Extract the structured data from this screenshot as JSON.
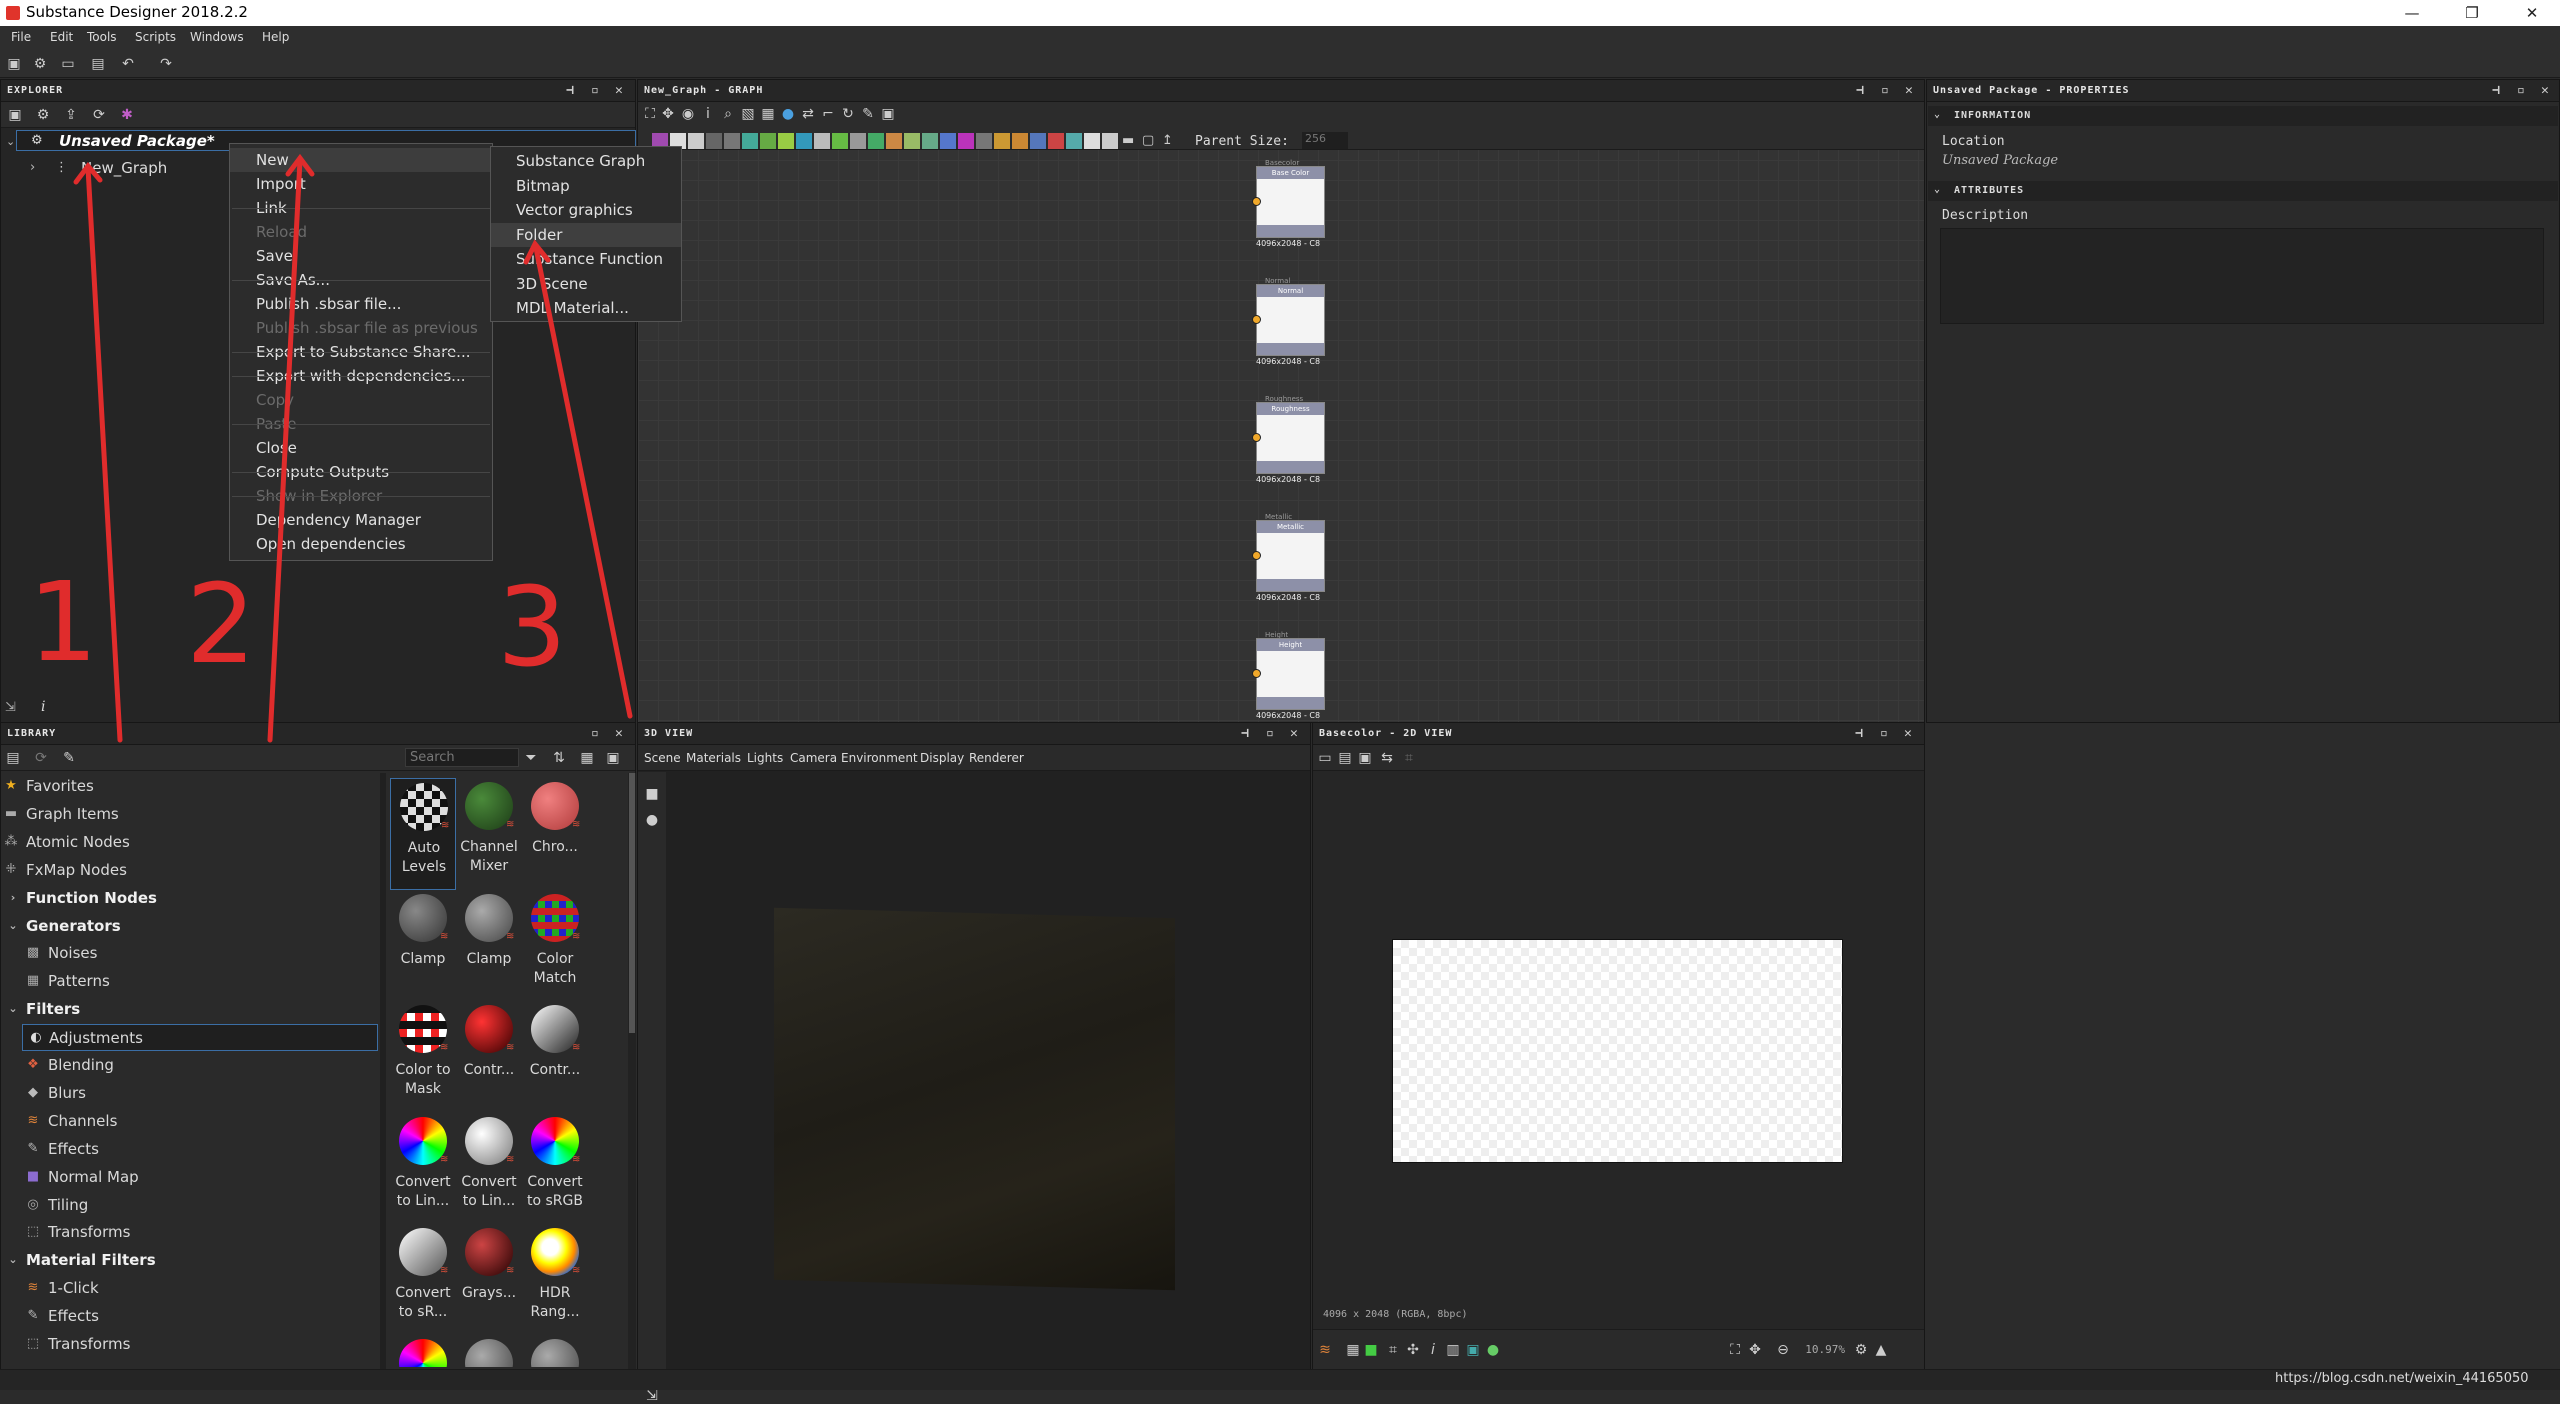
{
  "app": {
    "title": "Substance Designer 2018.2.2"
  },
  "window": {
    "minimize": "—",
    "restore": "❐",
    "close": "✕"
  },
  "menubar": [
    "File",
    "Edit",
    "Tools",
    "Scripts",
    "Windows",
    "Help"
  ],
  "explorer": {
    "title": "EXPLORER",
    "package": "Unsaved Package*",
    "graph": "New_Graph"
  },
  "context_menu": {
    "items": [
      {
        "label": "New",
        "enabled": true,
        "submenu": true,
        "highlight": true
      },
      {
        "label": "Import",
        "enabled": true,
        "submenu": true
      },
      {
        "label": "Link",
        "enabled": true,
        "submenu": true
      },
      {
        "label": "Reload",
        "enabled": false
      },
      {
        "label": "Save",
        "enabled": true
      },
      {
        "label": "Save As...",
        "enabled": true
      },
      {
        "label": "Publish .sbsar file...",
        "enabled": true
      },
      {
        "label": "Publish .sbsar file as previous",
        "enabled": false
      },
      {
        "label": "Export to Substance Share...",
        "enabled": true,
        "submenu": true
      },
      {
        "label": "Export with dependencies...",
        "enabled": true
      },
      {
        "label": "Copy",
        "enabled": false
      },
      {
        "label": "Paste",
        "enabled": false
      },
      {
        "label": "Close",
        "enabled": true
      },
      {
        "label": "Compute Outputs",
        "enabled": true
      },
      {
        "label": "Show in Explorer",
        "enabled": false
      },
      {
        "label": "Dependency Manager",
        "enabled": true
      },
      {
        "label": "Open dependencies",
        "enabled": true
      }
    ]
  },
  "submenu": {
    "items": [
      {
        "label": "Substance Graph"
      },
      {
        "label": "Bitmap"
      },
      {
        "label": "Vector graphics"
      },
      {
        "label": "Folder",
        "highlight": true
      },
      {
        "label": "Substance Function"
      },
      {
        "label": "3D Scene",
        "submenu": true
      },
      {
        "label": "MDL Material..."
      }
    ]
  },
  "annotations": [
    "1",
    "2",
    "3"
  ],
  "graph_panel": {
    "title": "New_Graph - GRAPH",
    "parent_size_label": "Parent Size:",
    "parent_size_value": "256",
    "nodes": [
      {
        "top": "Basecolor",
        "head": "Base Color",
        "label": "4096x2048 - C8"
      },
      {
        "top": "Normal",
        "head": "Normal",
        "label": "4096x2048 - C8"
      },
      {
        "top": "Roughness",
        "head": "Roughness",
        "label": "4096x2048 - C8"
      },
      {
        "top": "Metallic",
        "head": "Metallic",
        "label": "4096x2048 - C8"
      },
      {
        "top": "Height",
        "head": "Height",
        "label": "4096x2048 - C8"
      }
    ]
  },
  "properties": {
    "title": "Unsaved Package - PROPERTIES",
    "information": "INFORMATION",
    "location_label": "Location",
    "location_value": "Unsaved Package",
    "attributes": "ATTRIBUTES",
    "description_label": "Description"
  },
  "library": {
    "title": "LIBRARY",
    "search_placeholder": "Search",
    "categories": [
      {
        "label": "Favorites",
        "icon": "star-icon"
      },
      {
        "label": "Graph Items",
        "icon": "comment-icon"
      },
      {
        "label": "Atomic Nodes",
        "icon": "atom-icon"
      },
      {
        "label": "FxMap Nodes",
        "icon": "fxmap-icon"
      },
      {
        "label": "Function Nodes",
        "bold": true
      },
      {
        "label": "Generators",
        "bold": true
      },
      {
        "label": "Noises",
        "icon": "noise-icon"
      },
      {
        "label": "Patterns",
        "icon": "pattern-icon"
      },
      {
        "label": "Filters",
        "bold": true
      },
      {
        "label": "Adjustments",
        "icon": "adjust-icon",
        "selected": true
      },
      {
        "label": "Blending",
        "icon": "blend-icon"
      },
      {
        "label": "Blurs",
        "icon": "blur-icon"
      },
      {
        "label": "Channels",
        "icon": "channel-icon"
      },
      {
        "label": "Effects",
        "icon": "effect-icon"
      },
      {
        "label": "Normal Map",
        "icon": "normal-icon"
      },
      {
        "label": "Tiling",
        "icon": "tile-icon"
      },
      {
        "label": "Transforms",
        "icon": "transform-icon"
      },
      {
        "label": "Material Filters",
        "bold": true
      },
      {
        "label": "1-Click",
        "icon": "oneclick-icon"
      },
      {
        "label": "Effects",
        "icon": "effect-icon"
      },
      {
        "label": "Transforms",
        "icon": "transform-icon"
      }
    ],
    "thumbs": [
      {
        "label": "Auto Levels"
      },
      {
        "label": "Channel Mixer"
      },
      {
        "label": "Chro..."
      },
      {
        "label": "Clamp"
      },
      {
        "label": "Clamp"
      },
      {
        "label": "Color Match"
      },
      {
        "label": "Color to Mask"
      },
      {
        "label": "Contr..."
      },
      {
        "label": "Contr..."
      },
      {
        "label": "Convert to Lin..."
      },
      {
        "label": "Convert to Lin..."
      },
      {
        "label": "Convert to sRGB"
      },
      {
        "label": "Convert to sR..."
      },
      {
        "label": "Grays..."
      },
      {
        "label": "HDR Rang..."
      }
    ]
  },
  "view3d": {
    "title": "3D VIEW",
    "menu": [
      "Scene",
      "Materials",
      "Lights",
      "Camera",
      "Environment",
      "Display",
      "Renderer"
    ]
  },
  "view2d": {
    "title": "Basecolor - 2D VIEW",
    "info": "4096 x 2048 (RGBA, 8bpc)",
    "zoom": "10.97%"
  },
  "status": {
    "watermark": "https://blog.csdn.net/weixin_44165050"
  }
}
